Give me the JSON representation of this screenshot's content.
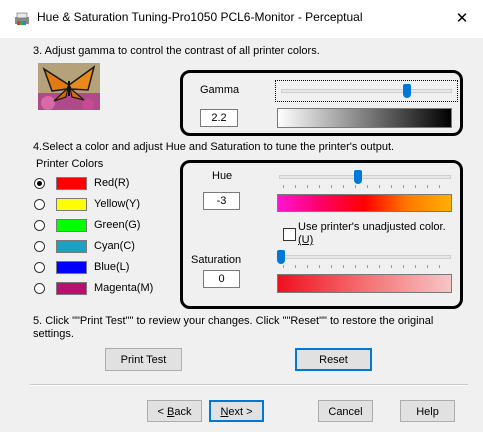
{
  "window": {
    "title": "Hue & Saturation Tuning-Pro1050 PCL6-Monitor - Perceptual",
    "close_glyph": "✕"
  },
  "gamma_section": {
    "instruction": "3. Adjust gamma to control the contrast of all printer colors.",
    "label": "Gamma",
    "value": "2.2",
    "slider_level": 0.73
  },
  "color_section": {
    "instruction": "4.Select a color and adjust Hue and Saturation to tune the printer's output.",
    "group_label": "Printer Colors",
    "colors": [
      {
        "label": "Red(R)",
        "swatch": "#ff0000",
        "selected": true
      },
      {
        "label": "Yellow(Y)",
        "swatch": "#ffff00",
        "selected": false
      },
      {
        "label": "Green(G)",
        "swatch": "#00ff00",
        "selected": false
      },
      {
        "label": "Cyan(C)",
        "swatch": "#1aa1c4",
        "selected": false
      },
      {
        "label": "Blue(L)",
        "swatch": "#0000ff",
        "selected": false
      },
      {
        "label": "Magenta(M)",
        "swatch": "#b8106e",
        "selected": false
      }
    ]
  },
  "hue": {
    "label": "Hue",
    "value": "-3",
    "slider_level": 0.46
  },
  "unadjusted_checkbox": {
    "label_line1": "Use printer's unadjusted color.",
    "label_line2": "(U)",
    "checked": false
  },
  "saturation": {
    "label": "Saturation",
    "value": "0",
    "slider_level": 0.0
  },
  "step5": {
    "instruction_line1": "5. Click \"\"Print Test\"\" to review your changes. Click \"\"Reset\"\" to restore the original",
    "instruction_line2": "settings."
  },
  "buttons": {
    "print_test": "Print Test",
    "reset": "Reset",
    "back_key": "B",
    "back_rest": "ack",
    "back_prefix": "< ",
    "next_key": "N",
    "next_rest": "ext >",
    "cancel": "Cancel",
    "help": "Help"
  },
  "colors": {
    "dialog_bg": "#f0f0f0",
    "accent": "#0078d7"
  }
}
